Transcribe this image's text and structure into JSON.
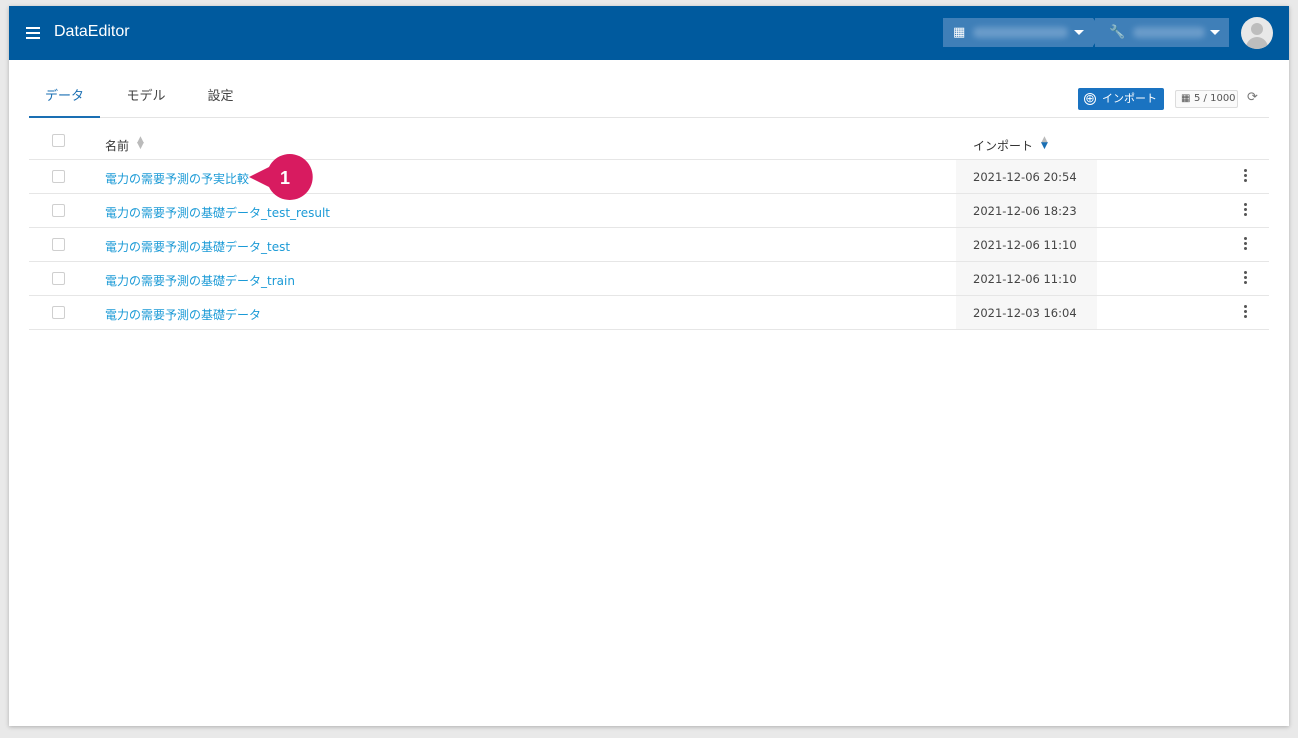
{
  "app": {
    "title": "DataEditor",
    "accent_color": "#005a9e",
    "icons": {
      "menu": "hamburger-menu-icon",
      "org": "building-icon",
      "project": "wrench-icon"
    }
  },
  "header": {
    "org_selector_icon": "▦",
    "project_selector_icon": "🔧"
  },
  "tabs": [
    {
      "label": "データ",
      "active": true
    },
    {
      "label": "モデル",
      "active": false
    },
    {
      "label": "設定",
      "active": false
    }
  ],
  "toolbar": {
    "import_label": "インポート",
    "import_icon": "⊕",
    "count_icon": "▦",
    "count": "5 / 1000",
    "refresh_icon": "⟳"
  },
  "table": {
    "columns": {
      "name": "名前",
      "import": "インポート"
    },
    "sort_icon": "⇕",
    "rows": [
      {
        "name": "電力の需要予測の予実比較",
        "imported": "2021-12-06 20:54"
      },
      {
        "name": "電力の需要予測の基礎データ_test_result",
        "imported": "2021-12-06 18:23"
      },
      {
        "name": "電力の需要予測の基礎データ_test",
        "imported": "2021-12-06 11:10"
      },
      {
        "name": "電力の需要予測の基礎データ_train",
        "imported": "2021-12-06 11:10"
      },
      {
        "name": "電力の需要予測の基礎データ",
        "imported": "2021-12-03 16:04"
      }
    ]
  },
  "annotation": {
    "number": "1",
    "color": "#d81b60"
  }
}
